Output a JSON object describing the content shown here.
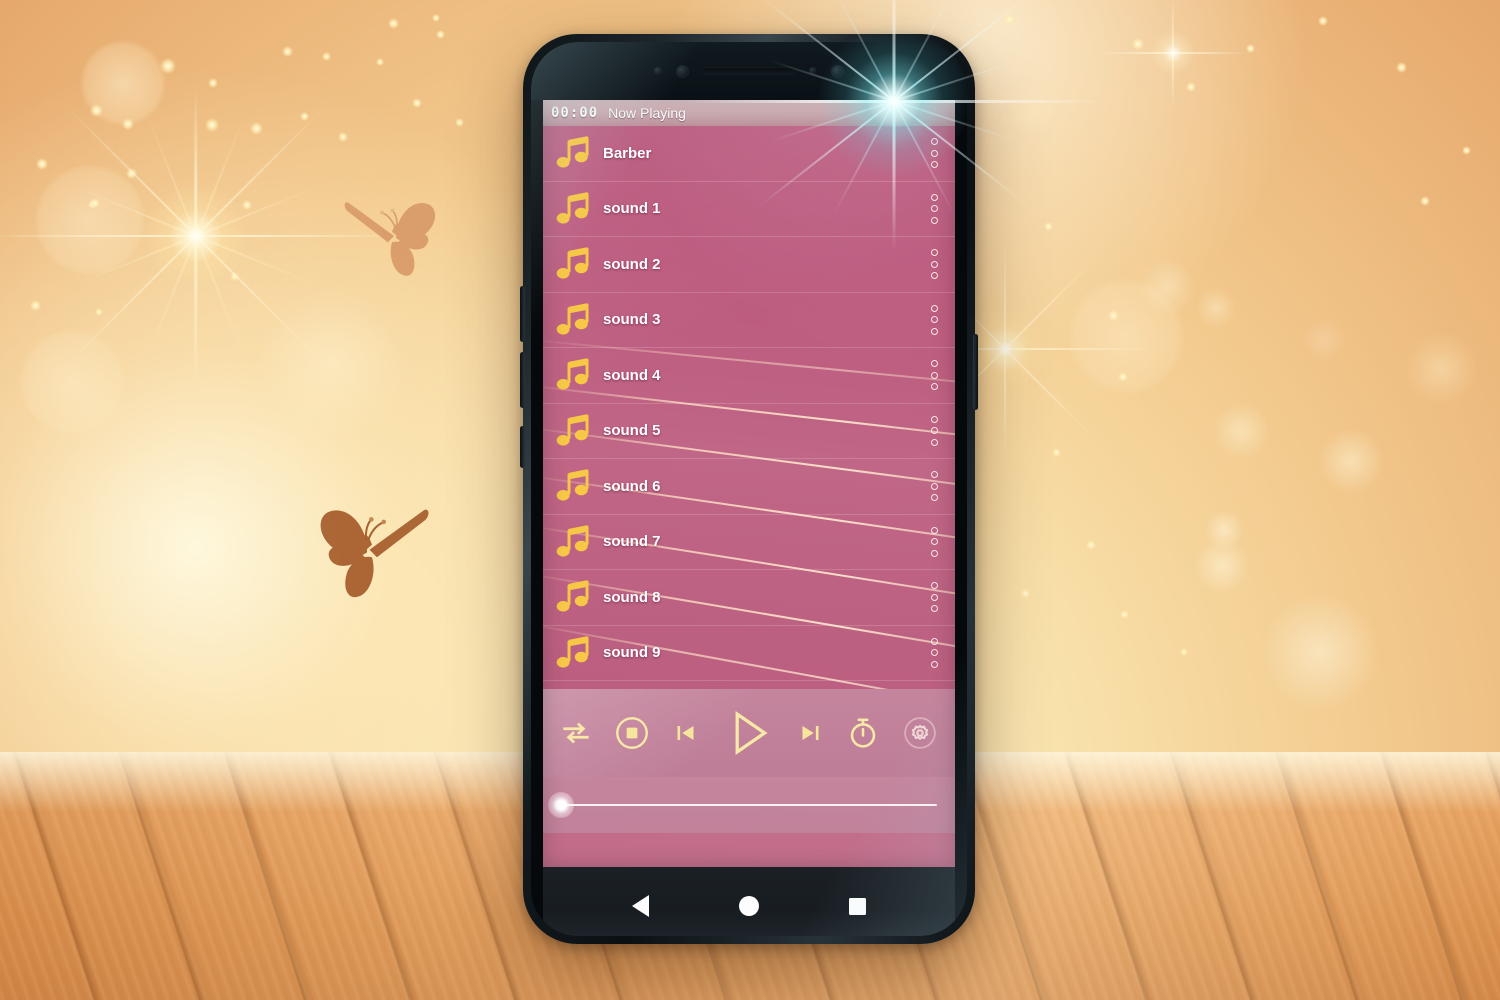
{
  "scene": {
    "description": "Android phone mockup on a wooden floor with a warm golden bokeh wall background",
    "accent_gold": "#f5c84a",
    "screen_pink": "#bd5d80",
    "control_bar_pink": "#c4869e",
    "floor_wood": "#e8a464",
    "wall_warm": "#f2c88c",
    "butterfly_light": "#d99a6c",
    "butterfly_dark": "#a85f33"
  },
  "phone": {
    "status_bar": {
      "clock": "00:00",
      "title": "Now Playing"
    },
    "playlist": {
      "items": [
        {
          "label": "Barber",
          "icon": "music-note-icon",
          "menu": "overflow-menu-icon"
        },
        {
          "label": "sound 1",
          "icon": "music-note-icon",
          "menu": "overflow-menu-icon"
        },
        {
          "label": "sound 2",
          "icon": "music-note-icon",
          "menu": "overflow-menu-icon"
        },
        {
          "label": "sound 3",
          "icon": "music-note-icon",
          "menu": "overflow-menu-icon"
        },
        {
          "label": "sound 4",
          "icon": "music-note-icon",
          "menu": "overflow-menu-icon"
        },
        {
          "label": "sound 5",
          "icon": "music-note-icon",
          "menu": "overflow-menu-icon"
        },
        {
          "label": "sound 6",
          "icon": "music-note-icon",
          "menu": "overflow-menu-icon"
        },
        {
          "label": "sound 7",
          "icon": "music-note-icon",
          "menu": "overflow-menu-icon"
        },
        {
          "label": "sound 8",
          "icon": "music-note-icon",
          "menu": "overflow-menu-icon"
        },
        {
          "label": "sound 9",
          "icon": "music-note-icon",
          "menu": "overflow-menu-icon"
        }
      ]
    },
    "controls": [
      {
        "name": "repeat-button",
        "icon": "repeat-icon"
      },
      {
        "name": "stop-button",
        "icon": "stop-circle-icon"
      },
      {
        "name": "previous-button",
        "icon": "skip-previous-icon"
      },
      {
        "name": "play-button",
        "icon": "play-icon"
      },
      {
        "name": "next-button",
        "icon": "skip-next-icon"
      },
      {
        "name": "timer-button",
        "icon": "stopwatch-icon"
      },
      {
        "name": "settings-button",
        "icon": "gear-icon"
      }
    ],
    "seek_bar": {
      "name": "seek-slider",
      "value": 0,
      "min": 0,
      "max": 100
    },
    "nav_bar": [
      {
        "name": "nav-back-button",
        "icon": "back-triangle-icon"
      },
      {
        "name": "nav-home-button",
        "icon": "home-circle-icon"
      },
      {
        "name": "nav-recents-button",
        "icon": "recents-square-icon"
      }
    ]
  }
}
